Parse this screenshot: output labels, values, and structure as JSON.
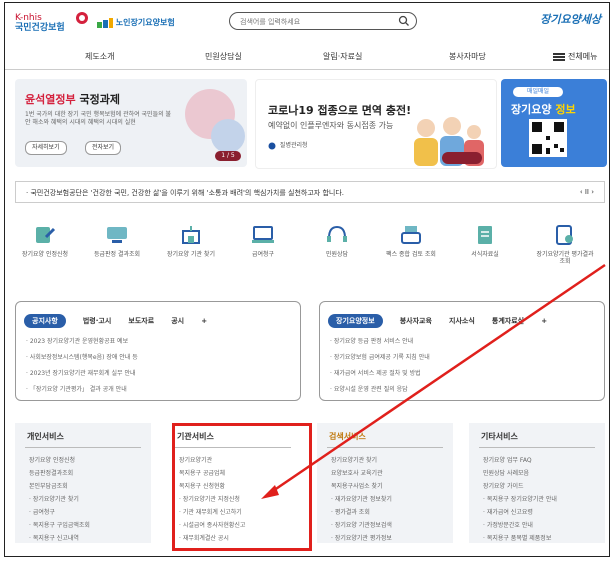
{
  "header": {
    "logo_top": "K-nhis",
    "logo_main": "국민건강보험",
    "logo_sub": "노인장기요양보험",
    "search_placeholder": "검색어를 입력하세요",
    "brand": "장기요양세상"
  },
  "nav": {
    "items": [
      "제도소개",
      "민원상담실",
      "알림·자료실",
      "봉사자마당"
    ],
    "all_menu": "전체메뉴"
  },
  "banner1": {
    "title_accent": "윤석열정부",
    "title_rest": "국정과제",
    "desc": "1번 국가의 대한 장기 국민 행복보험에 관하여 국민들의 불안 해소와 혜택의 시대의 혜택의 시대의 실현",
    "btn1": "자세히보기",
    "btn2": "전자보기",
    "pager": "1 / 5"
  },
  "banner2": {
    "title": "코로나19 접종으로 면역 충전!",
    "desc": "예약없이 인플루엔자와 동시접종 가능",
    "org": "질병관리청"
  },
  "banner3": {
    "tag": "매일매일",
    "title_main": "장기요양",
    "title_accent": "정보"
  },
  "notice": {
    "text": "· 국민건강보험공단은 '건강한 국민, 건강한 삶'을 이루기 위해 '소통과 배려'의 핵심가치를 실천하고자 합니다.",
    "controls": "‹  II  ›"
  },
  "icons": [
    {
      "name": "long-term-care-apply-icon",
      "label": "장기요양 인정신청"
    },
    {
      "name": "rating-result-icon",
      "label": "등급판정 결과조회"
    },
    {
      "name": "care-facility-search-icon",
      "label": "장기요양 기관 찾기"
    },
    {
      "name": "caregiver-payment-icon",
      "label": "급여청구"
    },
    {
      "name": "counsel-icon",
      "label": "민원상담"
    },
    {
      "name": "fax-icon",
      "label": "팩스 종합 검토 조회"
    },
    {
      "name": "document-icon",
      "label": "서식자료실"
    },
    {
      "name": "evaluation-icon",
      "label": "장기요양기관 평가결과 조회"
    }
  ],
  "board_left": {
    "tabs": [
      "공지사항",
      "법령·고시",
      "보도자료",
      "공시"
    ],
    "plus": "+",
    "items": [
      "· 2023 장기요양기관 운영현황공표 예보",
      "· 사회보장정보시스템(행복e음) 장애 안내 등",
      "· 2023년 장기요양기관 재무회계 실무 안내",
      "· 「장기요양 기관평가」 결과 공개 안내"
    ]
  },
  "board_right": {
    "tabs": [
      "장기요양정보",
      "봉사자교육",
      "지사소식",
      "통계자료실"
    ],
    "plus": "+",
    "items": [
      "· 장기요양 등급 판정 서비스 안내",
      "· 장기요양보험 급여제공 기록 지침 안내",
      "· 재가급여 서비스 제공 절차 및 방법",
      "· 요양시설 운영 관련 질의 응답"
    ]
  },
  "services": [
    {
      "title": "개인서비스",
      "items": [
        "장기요양 인정신청",
        "등급판정결과조회",
        "본인부담금조회",
        "· 장기요양기관 찾기",
        "· 급여청구",
        "· 복지용구 구입금액조회",
        "· 복지용구 신고내역"
      ]
    },
    {
      "title": "기관서비스",
      "items": [
        "장기요양기관",
        "복지용구 공급업체",
        "복지용구 신청현황",
        "· 장기요양기관 지정신청",
        "· 기관 재무회계 신고하기",
        "· 시설급여 종사자현황신고",
        "· 재무회계결산 공시"
      ]
    },
    {
      "title": "검색서비스",
      "items": [
        "장기요양기관 찾기",
        "요양보호사 교육기관",
        "복지용구사업소 찾기",
        "· 재가요양기관 정보찾기",
        "· 평가결과 조회",
        "· 장기요양 기관정보검색",
        "· 장기요양기관 평가정보"
      ]
    },
    {
      "title": "기타서비스",
      "items": [
        "장기요양 업무 FAQ",
        "민원상담 사례모음",
        "장기요양 가이드",
        "· 복지용구 장기요양기관 안내",
        "· 재가급여 신고요령",
        "· 가정방문간호 안내",
        "· 복지용구 품목별 제품정보"
      ]
    }
  ]
}
